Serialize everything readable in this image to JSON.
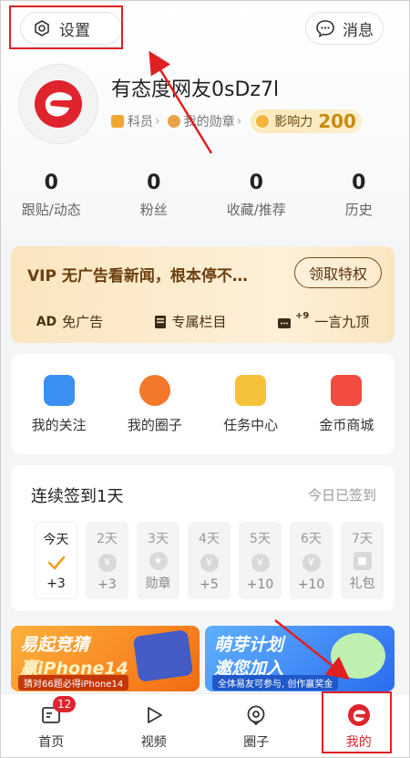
{
  "header": {
    "settings_label": "设置",
    "messages_label": "消息"
  },
  "profile": {
    "username": "有态度网友0sDz7l",
    "rank_label": "科员",
    "medal_label": "我的勋章",
    "influence_label": "影响力",
    "influence_score": "200"
  },
  "stats": [
    {
      "value": "0",
      "label": "跟贴/动态"
    },
    {
      "value": "0",
      "label": "粉丝"
    },
    {
      "value": "0",
      "label": "收藏/推荐"
    },
    {
      "value": "0",
      "label": "历史"
    }
  ],
  "vip": {
    "title": "VIP 无广告看新闻，根本停不…",
    "claim_label": "领取特权",
    "features": [
      {
        "icon": "AD",
        "label": "免广告"
      },
      {
        "icon": "column-icon",
        "label": "专属栏目"
      },
      {
        "icon": "+9",
        "label": "一言九顶"
      }
    ]
  },
  "shortcuts": [
    {
      "label": "我的关注",
      "color": "#3a8ff0"
    },
    {
      "label": "我的圈子",
      "color": "#f2792c"
    },
    {
      "label": "任务中心",
      "color": "#f6c23a"
    },
    {
      "label": "金币商城",
      "color": "#f24b3f"
    }
  ],
  "checkin": {
    "title": "连续签到1天",
    "status": "今日已签到",
    "days": [
      {
        "day": "今天",
        "reward": "+3"
      },
      {
        "day": "2天",
        "reward": "+3"
      },
      {
        "day": "3天",
        "reward": "勋章"
      },
      {
        "day": "4天",
        "reward": "+5"
      },
      {
        "day": "5天",
        "reward": "+10"
      },
      {
        "day": "6天",
        "reward": "+10"
      },
      {
        "day": "7天",
        "reward": "礼包"
      }
    ]
  },
  "banners": [
    {
      "line1": "易起竞猜",
      "line2": "赢iPhone14",
      "line3": "猜对66题必得iPhone14"
    },
    {
      "line1": "萌芽计划",
      "line2": "邀您加入",
      "line3": "全体易友可参与, 创作赢奖金"
    }
  ],
  "tabbar": {
    "items": [
      {
        "label": "首页"
      },
      {
        "label": "视频"
      },
      {
        "label": "圈子"
      },
      {
        "label": "我的"
      }
    ],
    "badge": "12"
  },
  "colors": {
    "accent": "#e0242d",
    "annotation": "#e02020",
    "vip_text": "#6b3f10"
  }
}
